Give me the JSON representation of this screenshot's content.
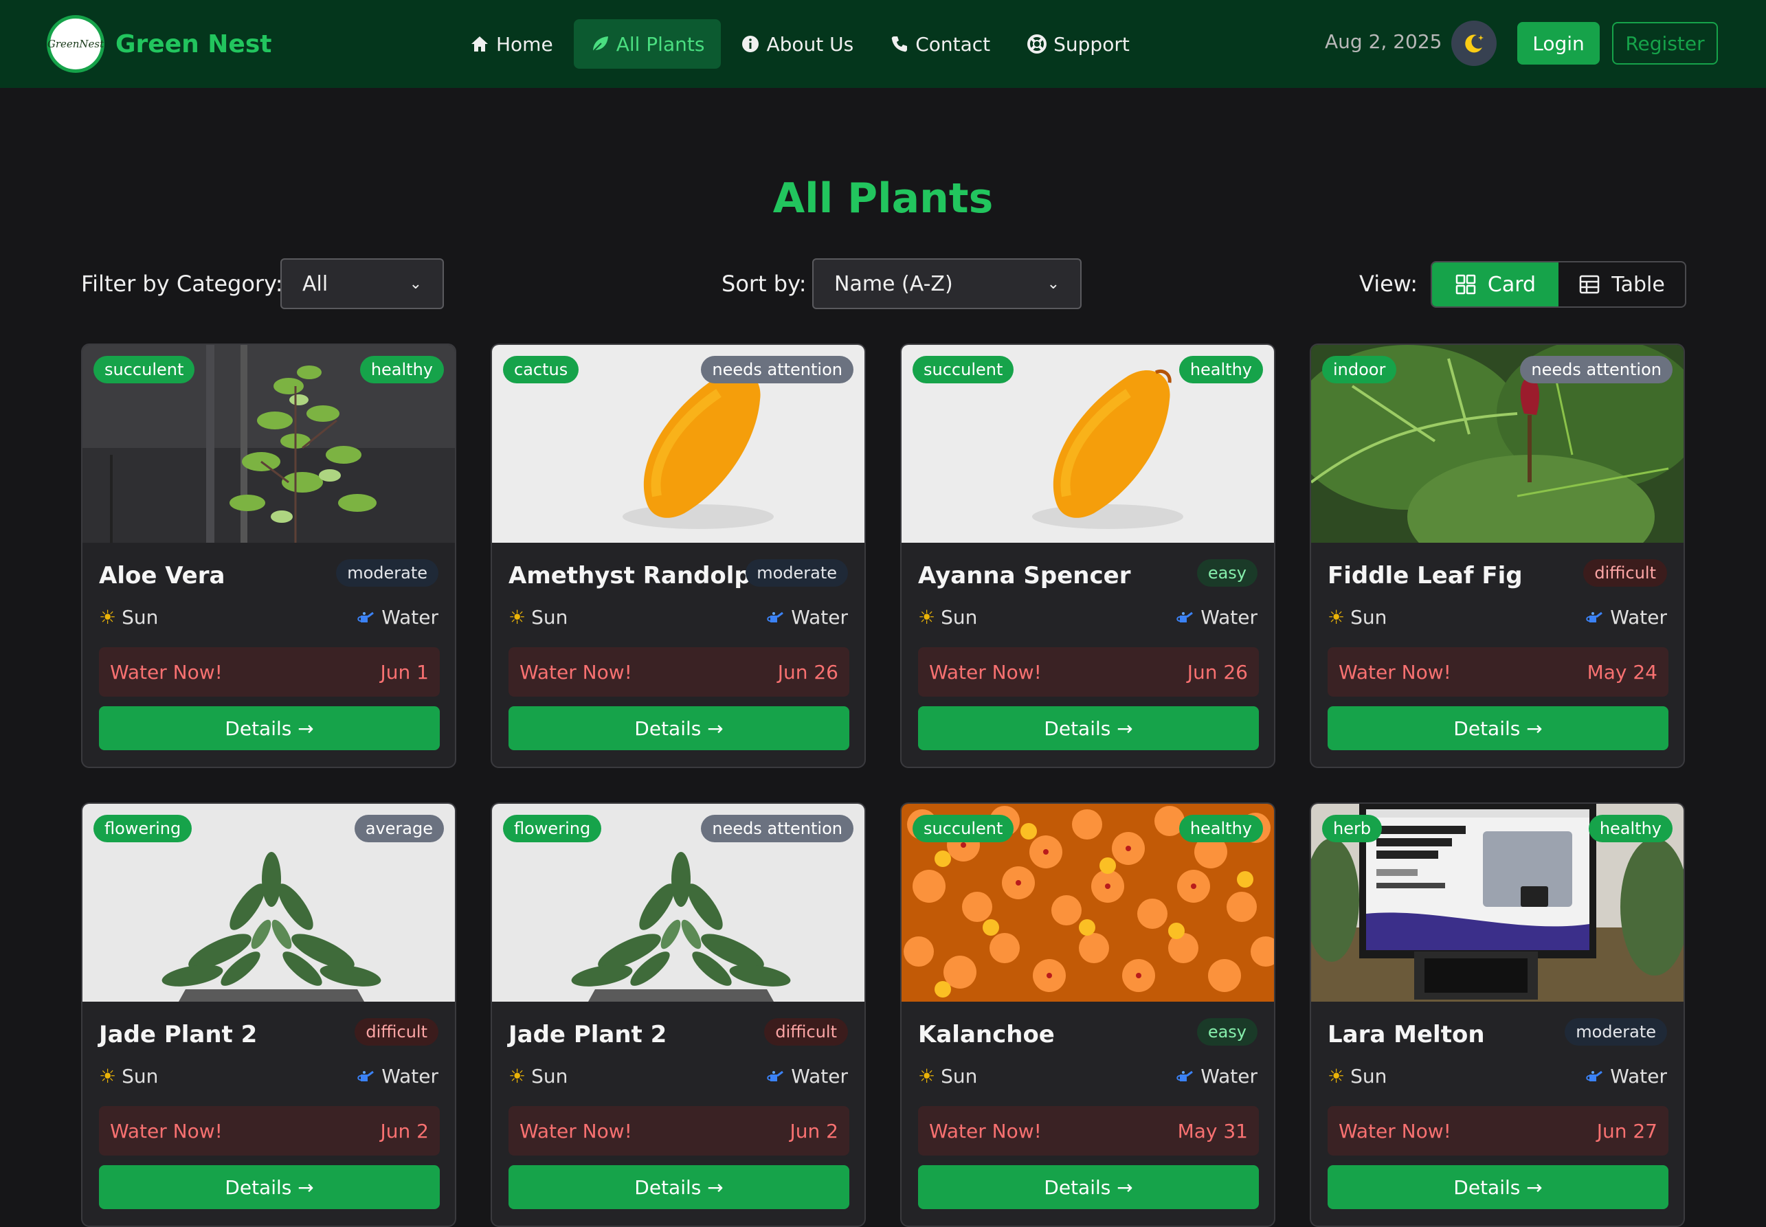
{
  "brand": {
    "logo_text": "GreenNest",
    "name": "Green Nest"
  },
  "nav": {
    "links": [
      {
        "label": "Home",
        "icon": "home-icon"
      },
      {
        "label": "All Plants",
        "icon": "leaf-icon"
      },
      {
        "label": "About Us",
        "icon": "info-icon"
      },
      {
        "label": "Contact",
        "icon": "phone-icon"
      },
      {
        "label": "Support",
        "icon": "lifebuoy-icon"
      }
    ],
    "date": "Aug 2, 2025",
    "theme_icon": "moon-icon",
    "login_label": "Login",
    "register_label": "Register"
  },
  "page": {
    "title": "All Plants",
    "filter_label": "Filter by Category:",
    "filter_value": "All",
    "sort_label": "Sort by:",
    "sort_value": "Name (A-Z)",
    "view_label": "View:",
    "view_card": "Card",
    "view_table": "Table"
  },
  "card_labels": {
    "sun": "Sun",
    "water": "Water",
    "water_now": "Water Now!",
    "details": "Details →",
    "sun_icon": "☀"
  },
  "plants": [
    {
      "name": "Aloe Vera",
      "category": "succulent",
      "health": "healthy",
      "difficulty": "moderate",
      "next_water": "Jun 1",
      "image": "leafy-plant"
    },
    {
      "name": "Amethyst Randolph",
      "category": "cactus",
      "health": "needs attention",
      "difficulty": "moderate",
      "next_water": "Jun 26",
      "image": "papaya"
    },
    {
      "name": "Ayanna Spencer",
      "category": "succulent",
      "health": "healthy",
      "difficulty": "easy",
      "next_water": "Jun 26",
      "image": "papaya"
    },
    {
      "name": "Fiddle Leaf Fig",
      "category": "indoor",
      "health": "needs attention",
      "difficulty": "difficult",
      "next_water": "May 24",
      "image": "fig-leaves"
    },
    {
      "name": "Jade Plant 2",
      "category": "flowering",
      "health": "average",
      "difficulty": "difficult",
      "next_water": "Jun 2",
      "image": "jade"
    },
    {
      "name": "Jade Plant 2",
      "category": "flowering",
      "health": "needs attention",
      "difficulty": "difficult",
      "next_water": "Jun 2",
      "image": "jade"
    },
    {
      "name": "Kalanchoe",
      "category": "succulent",
      "health": "healthy",
      "difficulty": "easy",
      "next_water": "May 31",
      "image": "orange-flowers"
    },
    {
      "name": "Lara Melton",
      "category": "herb",
      "health": "healthy",
      "difficulty": "moderate",
      "next_water": "Jun 27",
      "image": "monitor"
    }
  ],
  "colors": {
    "brand_green": "#22c55e",
    "button_green": "#16a34a",
    "navbar": "#04361c",
    "background": "#161618",
    "card": "#232326",
    "alert_text": "#f87171"
  }
}
